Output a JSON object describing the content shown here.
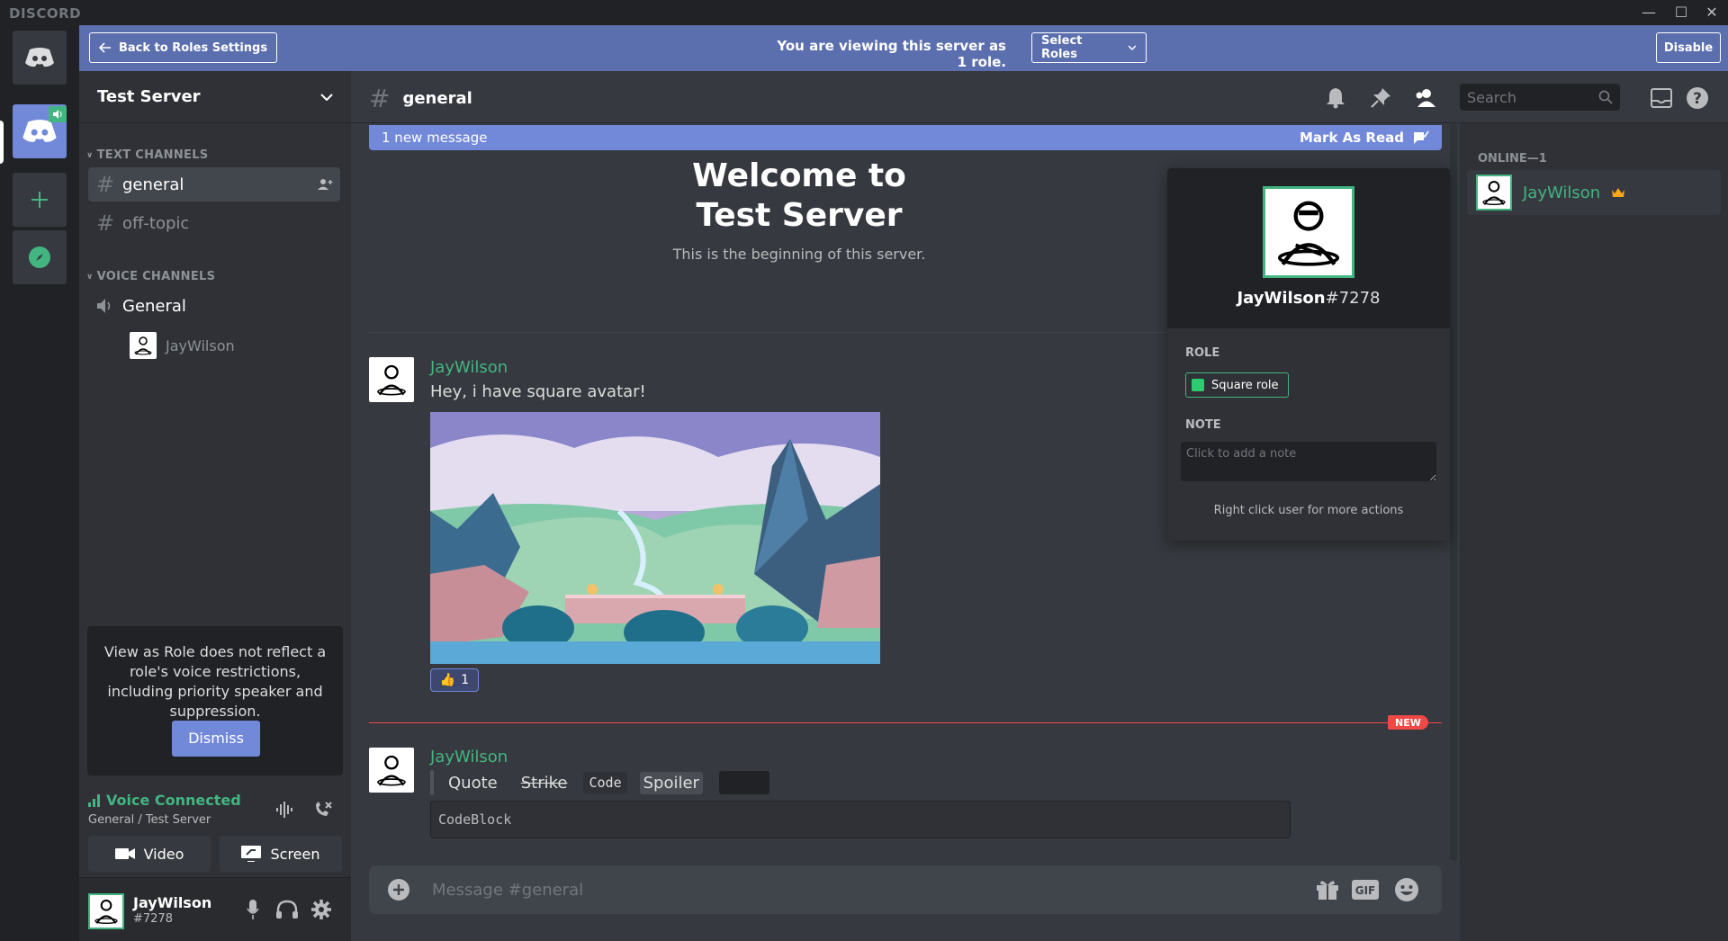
{
  "app": {
    "title": "DISCORD"
  },
  "window": {
    "minimize": "—",
    "maximize": "☐",
    "close": "✕"
  },
  "banner": {
    "back_label": "Back to Roles Settings",
    "message": "You are viewing this server as 1 role.",
    "select_roles": "Select Roles",
    "disable": "Disable"
  },
  "server": {
    "name": "Test Server",
    "text_category": "TEXT CHANNELS",
    "voice_category": "VOICE CHANNELS",
    "text_channels": [
      "general",
      "off-topic"
    ],
    "voice_channels": [
      "General"
    ],
    "voice_user": "JayWilson"
  },
  "notice": {
    "text": "View as Role does not reflect a role's voice restrictions, including priority speaker and suppression.",
    "dismiss": "Dismiss"
  },
  "voice": {
    "status": "Voice Connected",
    "location": "General / Test Server",
    "video": "Video",
    "screen": "Screen"
  },
  "user": {
    "name": "JayWilson",
    "discriminator": "#7278"
  },
  "chat": {
    "channel": "general",
    "search_placeholder": "Search",
    "new_messages": "1 new message",
    "mark_as_read": "Mark As Read",
    "welcome_line1": "Welcome to",
    "welcome_line2": "Test Server",
    "welcome_sub": "This is the beginning of this server.",
    "messages": [
      {
        "author": "JayWilson",
        "text": "Hey, i have square avatar!",
        "reaction_count": "1"
      },
      {
        "author": "JayWilson",
        "quote": "Quote",
        "strike": "Strike",
        "code": "Code",
        "spoiler": "Spoiler",
        "codeblock": "CodeBlock"
      }
    ],
    "new_tag": "NEW",
    "composer_placeholder": "Message #general",
    "gif": "GIF"
  },
  "popout": {
    "username": "JayWilson",
    "discriminator": "#7278",
    "role_label": "ROLE",
    "role_name": "Square role",
    "role_color": "#2ecc71",
    "note_label": "NOTE",
    "note_placeholder": "Click to add a note",
    "hint": "Right click user for more actions"
  },
  "members": {
    "category": "ONLINE—1",
    "list": [
      {
        "name": "JayWilson"
      }
    ]
  },
  "colors": {
    "accent": "#7289da",
    "online": "#43b581",
    "danger": "#f04747",
    "banner": "#5b6eae"
  }
}
